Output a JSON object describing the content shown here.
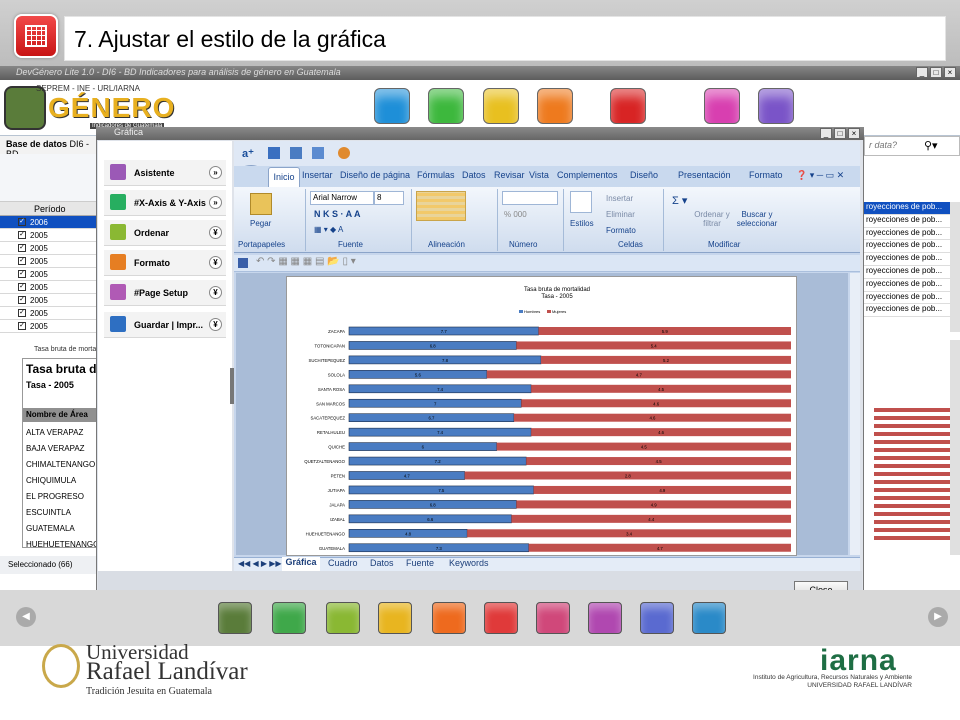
{
  "slide": {
    "title": "7. Ajustar el estilo de la gráfica"
  },
  "app": {
    "title": "DevGénero Lite 1.0 - DI6 - BD Indicadores para análisis de género en Guatemala",
    "logo_top": "SEPREM - INE - URL/IARNA",
    "logo_word": "GÉNERO",
    "logo_sub": "Indicadores de Guatemala",
    "db_label": "Base de datos",
    "db_value": "DI6 - BD",
    "search_placeholder": "r data?",
    "table_header": "Período",
    "rows": [
      "2006",
      "2005",
      "2005",
      "2005",
      "2005",
      "2005",
      "2005",
      "2005",
      "2005"
    ],
    "right_cells": [
      "royecciones de pob...",
      "royecciones de pob...",
      "royecciones de pob...",
      "royecciones de pob...",
      "royecciones de pob...",
      "royecciones de pob...",
      "royecciones de pob...",
      "royecciones de pob...",
      "royecciones de pob..."
    ],
    "preview_caption": "Tasa bruta de mortal",
    "preview_title": "Tasa bruta de",
    "preview_sub": "Tasa - 2005",
    "preview_col": "Nombre de Área",
    "preview_items": [
      "ALTA VERAPAZ",
      "BAJA VERAPAZ",
      "CHIMALTENANGO",
      "CHIQUIMULA",
      "EL PROGRESO",
      "ESCUINTLA",
      "GUATEMALA",
      "HUEHUETENANGO"
    ],
    "status": "Seleccionado (66)"
  },
  "dialog": {
    "title": "Gráfica",
    "side_items": [
      "Asistente",
      "#X-Axis & Y-Axis",
      "Ordenar",
      "Formato",
      "#Page Setup",
      "Guardar | Impr..."
    ],
    "close_label": "Close"
  },
  "excel": {
    "tabs": [
      "Inicio",
      "Insertar",
      "Diseño de página",
      "Fórmulas",
      "Datos",
      "Revisar",
      "Vista",
      "Complementos",
      "Diseño",
      "Presentación",
      "Formato"
    ],
    "font_name": "Arial Narrow",
    "font_size": "8",
    "groups": [
      "Portapapeles",
      "Fuente",
      "Alineación",
      "Número",
      "Celdas",
      "Modificar"
    ],
    "paste": "Pegar",
    "styles": "Estilos",
    "insert": "Insertar",
    "delete": "Eliminar",
    "format": "Formato",
    "sort": "Ordenar y filtrar",
    "find": "Buscar y seleccionar",
    "sheets": [
      "Gráfica",
      "Cuadro",
      "Datos",
      "Fuente",
      "Keywords"
    ]
  },
  "chart_data": {
    "type": "bar",
    "title": "Tasa bruta de mortalidad",
    "subtitle": "Tasa - 2005",
    "legend": [
      "Hombres",
      "Mujeres"
    ],
    "colors": {
      "Hombres": "#4a7cc2",
      "Mujeres": "#c0504d"
    },
    "categories": [
      "ZACAPA",
      "TOTONICAPAN",
      "SUCHITEPEQUEZ",
      "SOLOLA",
      "SANTA ROSA",
      "SAN MARCOS",
      "SACATEPEQUEZ",
      "RETALHULEU",
      "QUICHE",
      "QUETZALTENANGO",
      "PETEN",
      "JUTIAPA",
      "JALAPA",
      "IZABAL",
      "HUEHUETENANGO",
      "GUATEMALA"
    ],
    "series": [
      {
        "name": "Hombres",
        "values": [
          7.7,
          6.8,
          7.8,
          5.6,
          7.4,
          7,
          6.7,
          7.4,
          6,
          7.2,
          4.7,
          7.5,
          6.8,
          6.6,
          4.8,
          7.3
        ]
      },
      {
        "name": "Mujeres",
        "values": [
          5.9,
          5.4,
          5.2,
          4.7,
          4.5,
          4.6,
          4.6,
          4.6,
          4.5,
          4.5,
          2.8,
          4.9,
          4.9,
          4.4,
          3.4,
          4.7
        ]
      }
    ]
  }
}
